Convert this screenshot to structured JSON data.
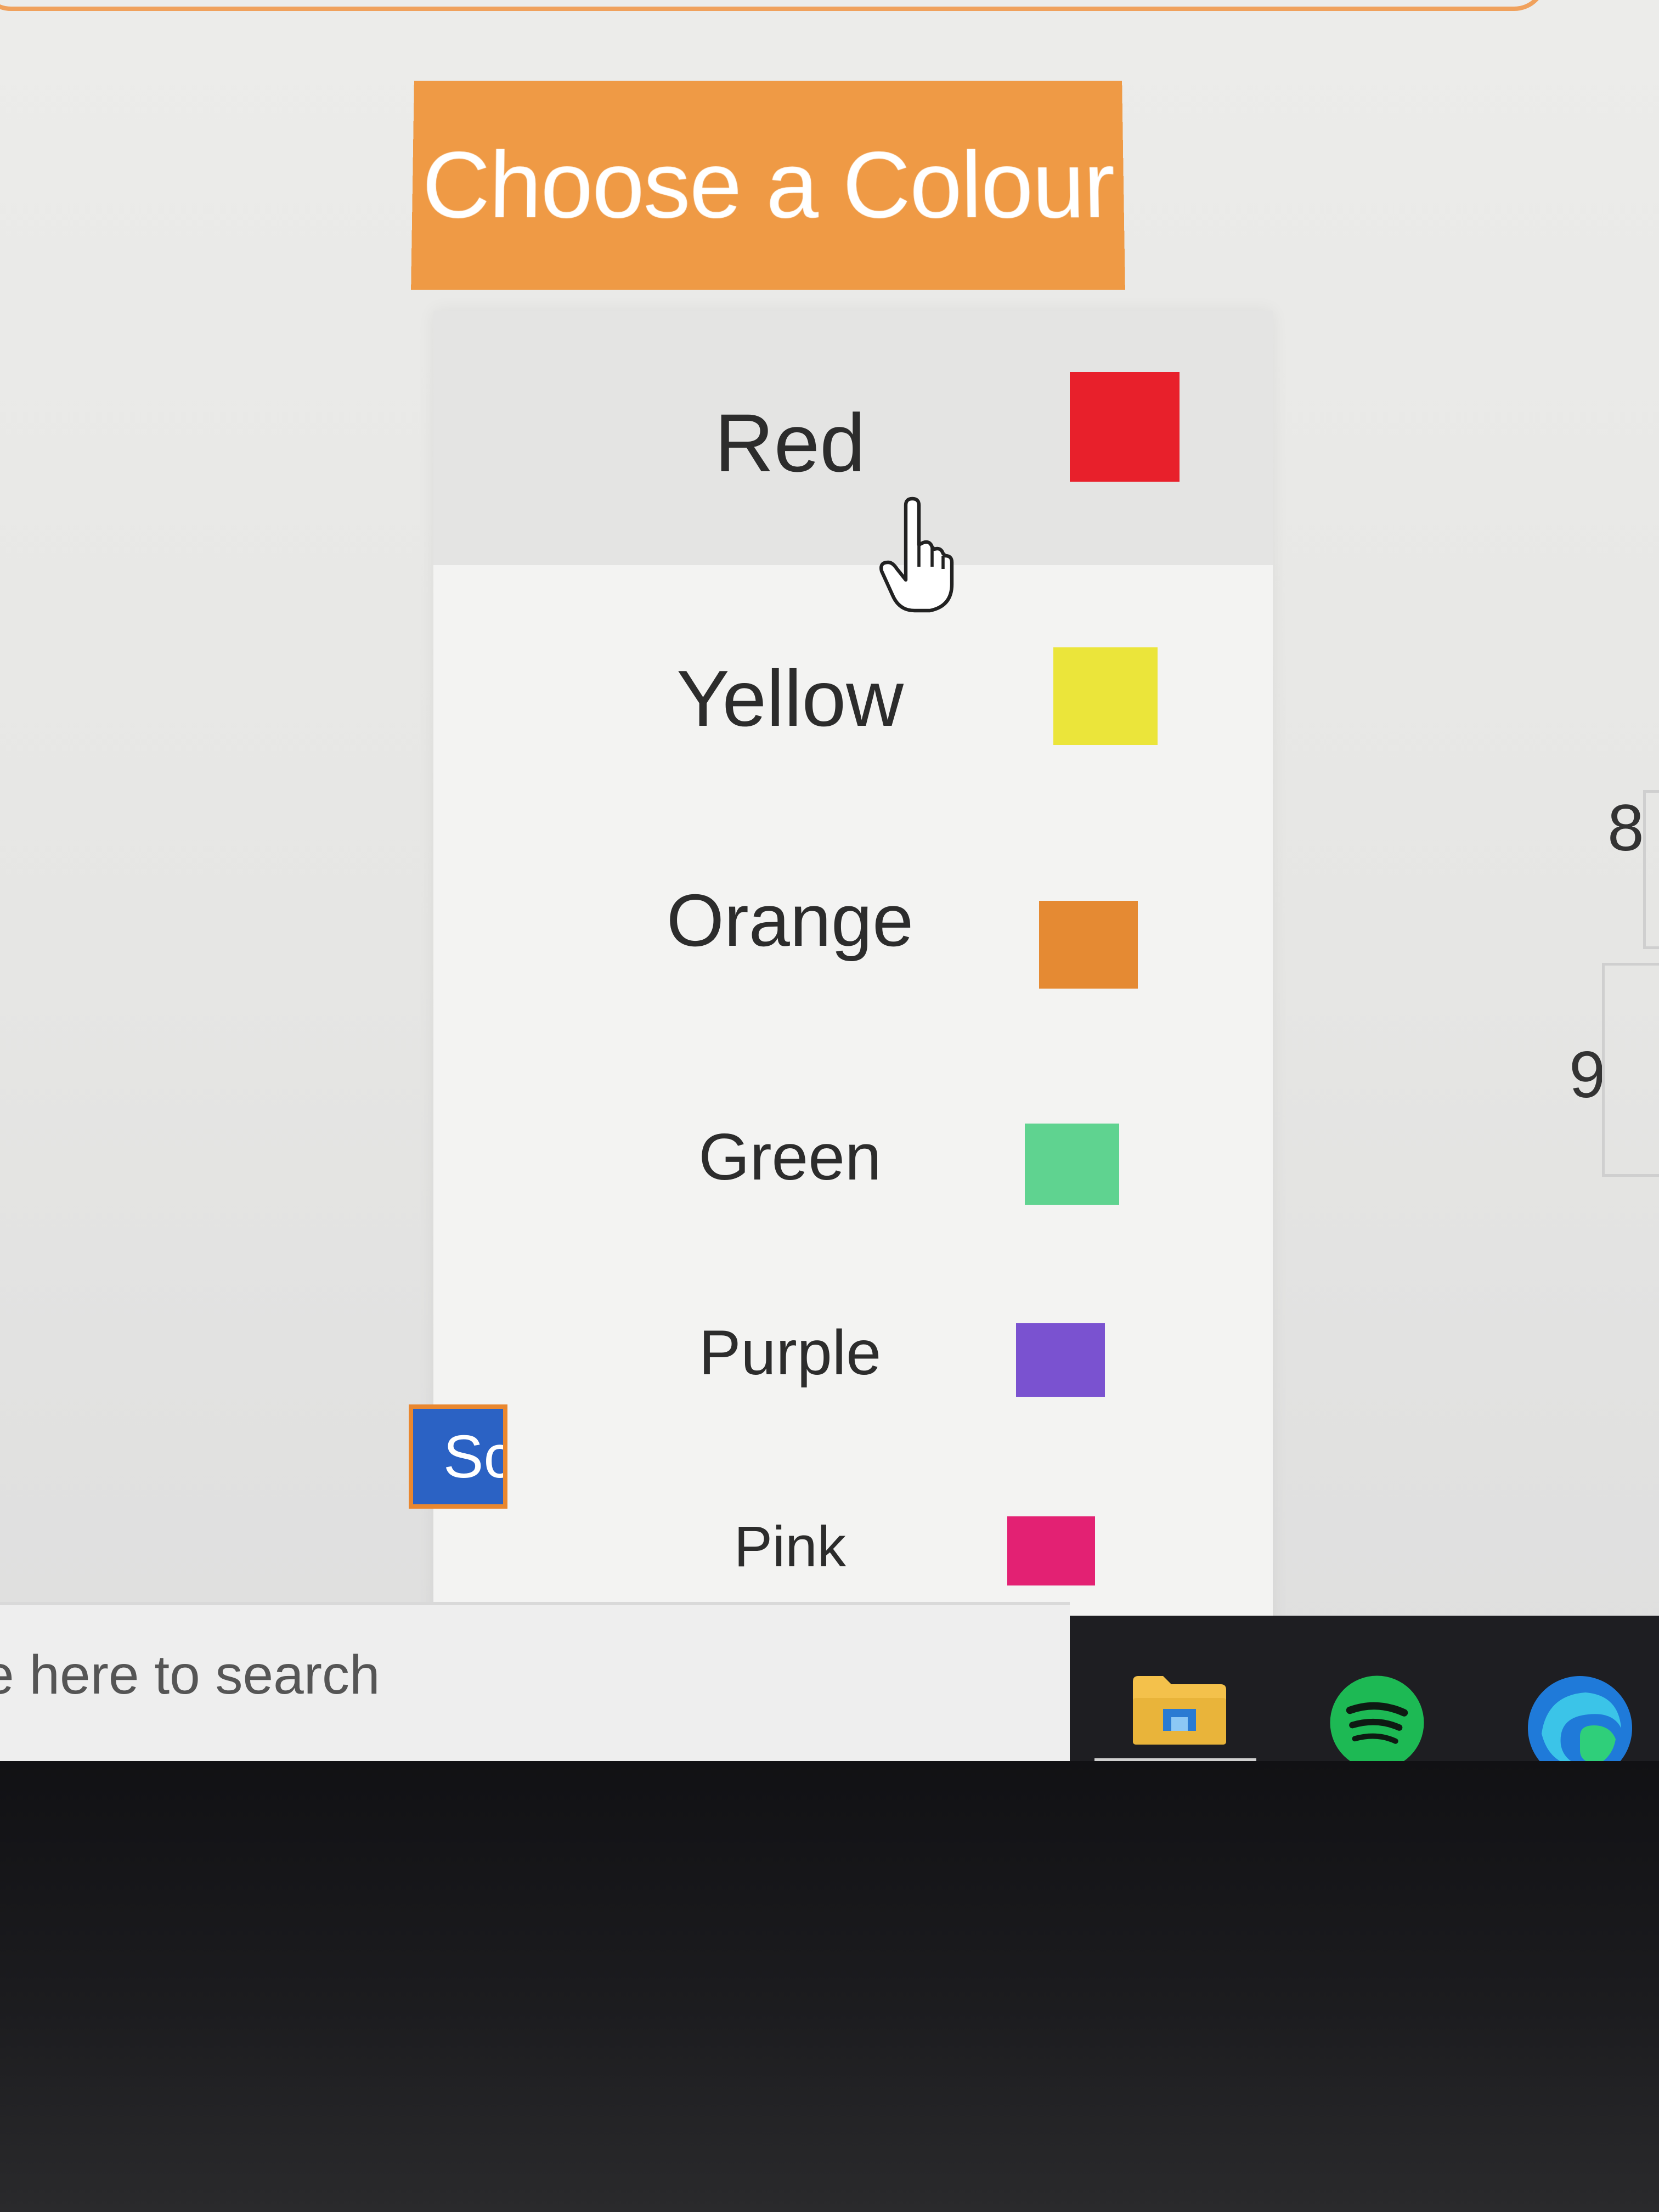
{
  "dropdown": {
    "title": "Choose a Colour",
    "header_color": "#ef9a45",
    "hovered_item": "Red",
    "items": [
      {
        "label": "Red",
        "swatch_color": "#e8202b"
      },
      {
        "label": "Yellow",
        "swatch_color": "#ebe53a"
      },
      {
        "label": "Orange",
        "swatch_color": "#e58a33"
      },
      {
        "label": "Green",
        "swatch_color": "#5fd390"
      },
      {
        "label": "Purple",
        "swatch_color": "#7a52d0"
      },
      {
        "label": "Pink",
        "swatch_color": "#e32173"
      }
    ]
  },
  "side_numbers": [
    "8",
    "9"
  ],
  "left_button": {
    "label": "Sc"
  },
  "taskbar": {
    "search_placeholder": "e here to search",
    "icons": [
      "file-explorer-icon",
      "spotify-icon",
      "edge-icon"
    ]
  }
}
